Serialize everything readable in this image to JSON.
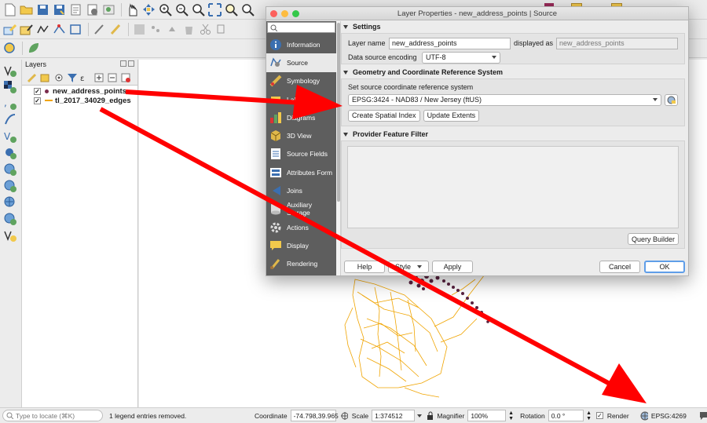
{
  "dialog": {
    "title": "Layer Properties - new_address_points | Source",
    "sidebar": {
      "items": [
        {
          "label": "Information",
          "icon": "information-icon"
        },
        {
          "label": "Source",
          "icon": "source-icon"
        },
        {
          "label": "Symbology",
          "icon": "symbology-icon"
        },
        {
          "label": "Labels",
          "icon": "labels-icon"
        },
        {
          "label": "Diagrams",
          "icon": "diagrams-icon"
        },
        {
          "label": "3D View",
          "icon": "cube-icon"
        },
        {
          "label": "Source Fields",
          "icon": "fields-icon"
        },
        {
          "label": "Attributes Form",
          "icon": "form-icon"
        },
        {
          "label": "Joins",
          "icon": "joins-icon"
        },
        {
          "label": "Auxiliary Storage",
          "icon": "database-icon"
        },
        {
          "label": "Actions",
          "icon": "gear-icon"
        },
        {
          "label": "Display",
          "icon": "speech-bubble-icon"
        },
        {
          "label": "Rendering",
          "icon": "brush-icon"
        }
      ]
    },
    "settings": {
      "header": "Settings",
      "layer_name_label": "Layer name",
      "layer_name_value": "new_address_points",
      "displayed_as_label": "displayed as",
      "displayed_as_value": "new_address_points",
      "encoding_label": "Data source encoding",
      "encoding_value": "UTF-8"
    },
    "geometry": {
      "header": "Geometry and Coordinate Reference System",
      "crs_label": "Set source coordinate reference system",
      "crs_value": "EPSG:3424 - NAD83 / New Jersey (ftUS)",
      "create_index_button": "Create Spatial Index",
      "update_extents_button": "Update Extents"
    },
    "filter": {
      "header": "Provider Feature Filter",
      "query_builder_button": "Query Builder"
    },
    "buttons": {
      "help": "Help",
      "style": "Style",
      "apply": "Apply",
      "cancel": "Cancel",
      "ok": "OK"
    }
  },
  "layers_panel": {
    "title": "Layers",
    "layers": [
      {
        "name": "new_address_points",
        "checked": true,
        "symbol_color": "#7a2c4d"
      },
      {
        "name": "tl_2017_34029_edges",
        "checked": true,
        "symbol_color": "#f0a400"
      }
    ]
  },
  "statusbar": {
    "locate_placeholder": "Type to locate (⌘K)",
    "message": "1 legend entries removed.",
    "coordinate_label": "Coordinate",
    "coordinate_value": "-74.798,39.965",
    "scale_label": "Scale",
    "scale_value": "1:374512",
    "magnifier_label": "Magnifier",
    "magnifier_value": "100%",
    "rotation_label": "Rotation",
    "rotation_value": "0.0 °",
    "render_label": "Render",
    "render_checked": true,
    "crs": "EPSG:4269"
  },
  "colors": {
    "annotation_arrow": "#ff0000",
    "edges_layer": "#f0a400",
    "points_layer": "#7a2c4d",
    "sidebar_bg": "#5e5e5e",
    "ok_focus": "#5f9ee8"
  }
}
